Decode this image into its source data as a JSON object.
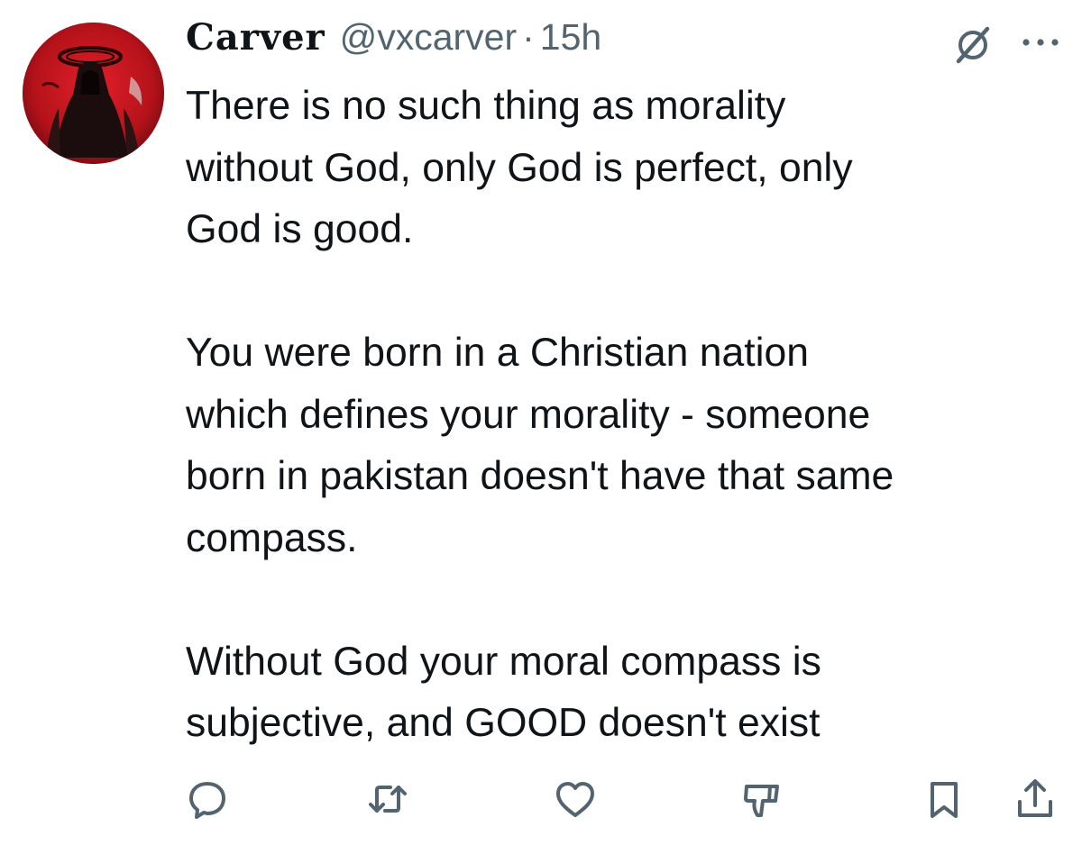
{
  "tweet": {
    "display_name": "Carver",
    "handle": "@vxcarver",
    "separator": "·",
    "time": "15h",
    "paragraphs": [
      [
        "There is no such thing as morality",
        "without God, only God is perfect, only",
        "God is good."
      ],
      [
        "You were born in a Christian nation",
        "which defines your morality - someone",
        "born in pakistan doesn't have that same",
        "compass."
      ],
      [
        "Without God your moral compass is",
        "subjective, and GOOD doesn't exist"
      ]
    ]
  },
  "icons": {
    "avatar": "avatar-image",
    "grok": "grok-icon",
    "more": "more-dots-icon",
    "reply": "reply-icon",
    "retweet": "retweet-icon",
    "like": "like-heart-icon",
    "stats": "analytics-icon",
    "bookmark": "bookmark-icon",
    "share": "share-icon"
  },
  "colors": {
    "text_primary": "#0f1419",
    "text_secondary": "#536471",
    "icon": "#536471",
    "avatar_red": "#c0141c"
  }
}
